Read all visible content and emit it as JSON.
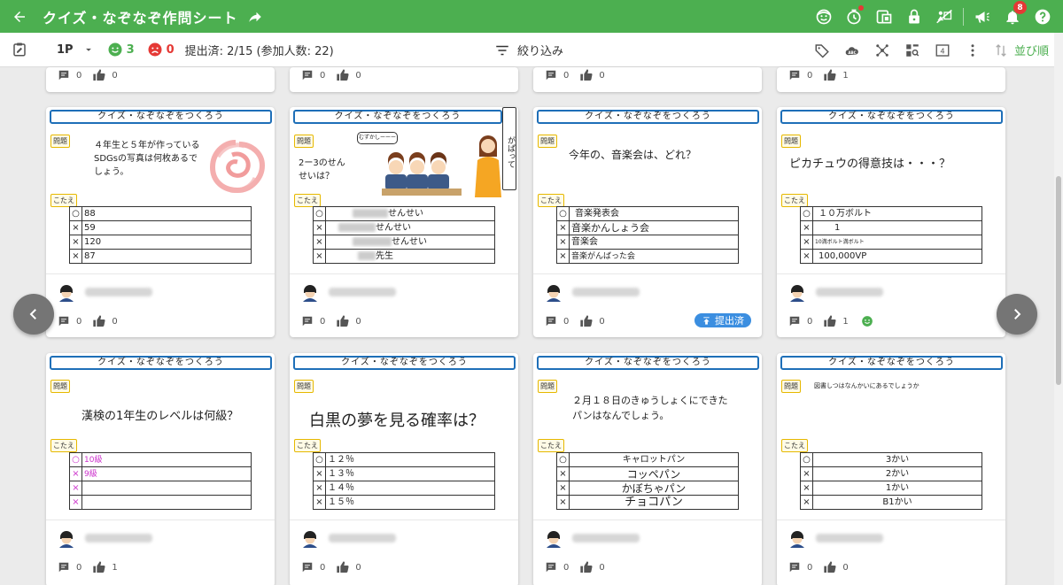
{
  "app": {
    "title": "クイズ・なぞなぞ作問シート",
    "notification_count": "8"
  },
  "icons": {
    "appbar": [
      "back-arrow-icon",
      "share-icon",
      "face-icon",
      "timer-icon",
      "qr-icon",
      "lock-icon",
      "anonymize-icon",
      "megaphone-icon",
      "bell-icon",
      "help-icon"
    ],
    "toolbar": [
      "clipboard-icon",
      "tag-icon",
      "handwriting-abc-icon",
      "layout-network-icon",
      "search-layout-icon",
      "column-count-icon",
      "more-vert-icon",
      "sort-icon"
    ]
  },
  "colors": {
    "appbar_green": "#4caf50",
    "header_border_blue": "#1e6fb8",
    "submitted_blue": "#3b8ee0",
    "negative_red": "#e53935"
  },
  "toolbar": {
    "page": "1P",
    "good_count": "3",
    "bad_count": "0",
    "status": "提出済: 2/15 (参加人数: 22)",
    "filter_label": "絞り込み",
    "columns": "4",
    "sort_label": "並び順"
  },
  "top_row": [
    {
      "comments": "0",
      "likes": "0"
    },
    {
      "comments": "0",
      "likes": "0"
    },
    {
      "comments": "0",
      "likes": "0"
    },
    {
      "comments": "0",
      "likes": "1"
    }
  ],
  "labels": {
    "header": "クイズ・なぞなぞをつくろう",
    "question_tag": "問題",
    "answer_tag": "こたえ",
    "submitted_badge": "提出済"
  },
  "cards": [
    {
      "question": "４年生と５年が作っているSDGsの写真は何枚あるでしょう。",
      "answers": [
        {
          "mark": "○",
          "text": "88"
        },
        {
          "mark": "×",
          "text": "59"
        },
        {
          "mark": "×",
          "text": "120"
        },
        {
          "mark": "×",
          "text": "87"
        }
      ],
      "comments": "0",
      "likes": "0"
    },
    {
      "question": "2ー3のせんせいは？",
      "speech": "むずかしーーー",
      "side_text": "がぱって",
      "answers": [
        {
          "mark": "○",
          "text": "せんせい"
        },
        {
          "mark": "×",
          "text": "せんせい"
        },
        {
          "mark": "×",
          "text": "せんせい"
        },
        {
          "mark": "×",
          "text": "先生"
        }
      ],
      "comments": "0",
      "likes": "0"
    },
    {
      "question": "今年の、音楽会は、どれ？",
      "answers": [
        {
          "mark": "○",
          "text": "音楽発表会"
        },
        {
          "mark": "×",
          "text": "音楽かんしょう会"
        },
        {
          "mark": "×",
          "text": "音楽会"
        },
        {
          "mark": "×",
          "text": "音楽がんばった会"
        }
      ],
      "comments": "0",
      "likes": "0",
      "submitted": true
    },
    {
      "question": "ピカチュウの得意技は・・・？",
      "answers": [
        {
          "mark": "○",
          "text": "１０万ボルト"
        },
        {
          "mark": "×",
          "text": "1"
        },
        {
          "mark": "×",
          "text": "10満ボルト満ボルト"
        },
        {
          "mark": "×",
          "text": "100,000VP"
        }
      ],
      "comments": "0",
      "likes": "1",
      "reaction": "good"
    },
    {
      "question": "漢検の1年生のレベルは何級？",
      "answers": [
        {
          "mark": "○",
          "text": "10級"
        },
        {
          "mark": "×",
          "text": "9級"
        },
        {
          "mark": "×",
          "text": ""
        },
        {
          "mark": "×",
          "text": ""
        }
      ],
      "comments": "0",
      "likes": "1"
    },
    {
      "question": "白黒の夢を見る確率は？",
      "answers": [
        {
          "mark": "○",
          "text": "１２％"
        },
        {
          "mark": "×",
          "text": "１３％"
        },
        {
          "mark": "×",
          "text": "１４％"
        },
        {
          "mark": "×",
          "text": "１５％"
        }
      ],
      "comments": "0",
      "likes": "0"
    },
    {
      "question": "２月１８日のきゅうしょくにできたパンはなんでしょう。",
      "answers": [
        {
          "mark": "○",
          "text": "キャロットパン"
        },
        {
          "mark": "×",
          "text": "コッペパン"
        },
        {
          "mark": "×",
          "text": "かぼちゃパン"
        },
        {
          "mark": "×",
          "text": "チョコパン"
        }
      ],
      "comments": "0",
      "likes": "0"
    },
    {
      "question": "図書しつはなんかいにあるでしょうか",
      "answers": [
        {
          "mark": "○",
          "text": "3かい"
        },
        {
          "mark": "×",
          "text": "2かい"
        },
        {
          "mark": "×",
          "text": "1かい"
        },
        {
          "mark": "×",
          "text": "B1かい"
        }
      ],
      "comments": "0",
      "likes": "0"
    }
  ]
}
